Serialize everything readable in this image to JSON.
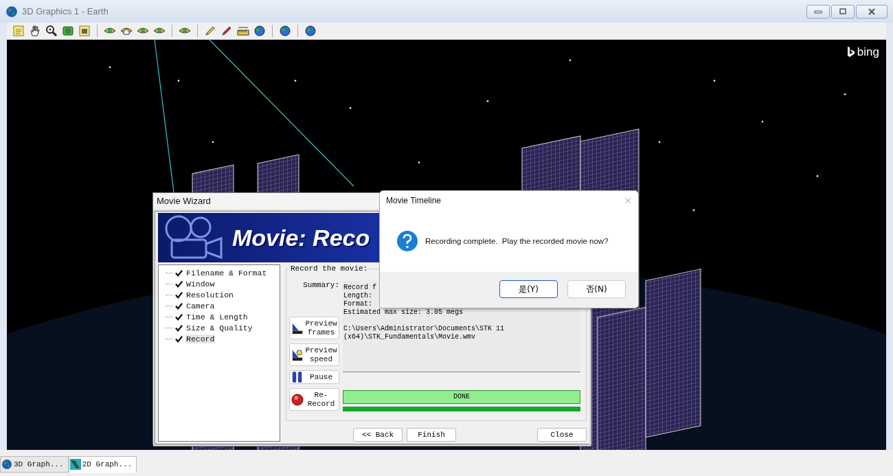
{
  "window": {
    "title": "3D Graphics 1 - Earth"
  },
  "map_attribution": "bing",
  "movie_wizard": {
    "title": "Movie Wizard",
    "banner_title": "Movie: Reco",
    "steps": [
      {
        "label": "Filename & Format",
        "checked": true,
        "selected": false
      },
      {
        "label": "Window",
        "checked": true,
        "selected": false
      },
      {
        "label": "Resolution",
        "checked": true,
        "selected": false
      },
      {
        "label": "Camera",
        "checked": true,
        "selected": false
      },
      {
        "label": "Time & Length",
        "checked": true,
        "selected": false
      },
      {
        "label": "Size & Quality",
        "checked": true,
        "selected": false
      },
      {
        "label": "Record",
        "checked": true,
        "selected": true
      }
    ],
    "group_title": "Record the movie:",
    "summary_label": "Summary:",
    "summary_lines": [
      "Record f",
      "Length:",
      "Format:",
      "Estimated max size: 3.05 megs"
    ],
    "file_path": "C:\\Users\\Administrator\\Documents\\STK 11 (x64)\\STK_Fundamentals\\Movie.wmv",
    "side_buttons": [
      {
        "kind": "preview-frames",
        "label": "Preview frames"
      },
      {
        "kind": "preview-speed",
        "label": "Preview speed"
      },
      {
        "kind": "pause",
        "label": "Pause"
      },
      {
        "kind": "record",
        "label": "Re-Record"
      }
    ],
    "status": "DONE",
    "progress": {
      "level": 1
    },
    "footer_buttons": [
      "<< Back",
      "Finish"
    ],
    "close_button": "Close"
  },
  "dialog": {
    "title": "Movie Timeline",
    "message": "Recording complete.  Play the recorded movie now?",
    "buttons": [
      {
        "label": "是(Y)",
        "default": true
      },
      {
        "label": "否(N)",
        "default": false
      }
    ]
  },
  "taskbar": [
    {
      "label": "3D Graph...",
      "kind": "globe",
      "selected": false
    },
    {
      "label": "2D Graph...",
      "kind": "map",
      "selected": true
    }
  ]
}
